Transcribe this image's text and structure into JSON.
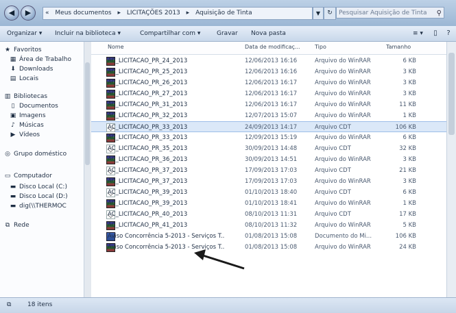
{
  "addressbar": {
    "segments": [
      "«",
      "Meus documentos",
      "▸",
      "LICITAÇÕES 2013",
      "▸",
      "Aquisição de Tinta"
    ],
    "search_placeholder": "Pesquisar Aquisição de Tinta"
  },
  "toolbar": {
    "organize": "Organizar ▾",
    "include": "Incluir na biblioteca ▾",
    "share": "Compartilhar com ▾",
    "burn": "Gravar",
    "newfolder": "Nova pasta",
    "view_icon": "≡ ▾",
    "pane_icon": "▯",
    "help_icon": "?"
  },
  "nav": {
    "favorites": "Favoritos",
    "desktop": "Área de Trabalho",
    "downloads": "Downloads",
    "recent": "Locais",
    "libraries": "Bibliotecas",
    "documents": "Documentos",
    "images": "Imagens",
    "music": "Músicas",
    "videos": "Vídeos",
    "homegroup": "Grupo doméstico",
    "computer": "Computador",
    "disk_c": "Disco Local (C:)",
    "disk_d": "Disco Local (D:)",
    "network_drive": "dig(\\\\THERMOC",
    "network": "Rede"
  },
  "columns": {
    "name": "Nome",
    "date": "Data de modificaç...",
    "type": "Tipo",
    "size": "Tamanho"
  },
  "files": [
    {
      "name": "AC_LICITACAO_PR_24_2013",
      "date": "12/06/2013 16:16",
      "type": "Arquivo do WinRAR",
      "size": "6 KB"
    },
    {
      "name": "AC_LICITACAO_PR_25_2013",
      "date": "12/06/2013 16:16",
      "type": "Arquivo do WinRAR",
      "size": "3 KB"
    },
    {
      "name": "AC_LICITACAO_PR_26_2013",
      "date": "12/06/2013 16:17",
      "type": "Arquivo do WinRAR",
      "size": "3 KB"
    },
    {
      "name": "AC_LICITACAO_PR_27_2013",
      "date": "12/06/2013 16:17",
      "type": "Arquivo do WinRAR",
      "size": "3 KB"
    },
    {
      "name": "AC_LICITACAO_PR_31_2013",
      "date": "12/06/2013 16:17",
      "type": "Arquivo do WinRAR",
      "size": "11 KB"
    },
    {
      "name": "AC_LICITACAO_PR_32_2013",
      "date": "12/07/2013 15:07",
      "type": "Arquivo do WinRAR",
      "size": "1 KB"
    },
    {
      "name": "AC_LICITACAO_PR_33_2013",
      "date": "24/09/2013 14:17",
      "type": "Arquivo CDT",
      "size": "106 KB"
    },
    {
      "name": "AC_LICITACAO_PR_33_2013",
      "date": "12/09/2013 15:19",
      "type": "Arquivo do WinRAR",
      "size": "6 KB"
    },
    {
      "name": "AC_LICITACAO_PR_35_2013",
      "date": "30/09/2013 14:48",
      "type": "Arquivo CDT",
      "size": "32 KB"
    },
    {
      "name": "AC_LICITACAO_PR_36_2013",
      "date": "30/09/2013 14:51",
      "type": "Arquivo do WinRAR",
      "size": "3 KB"
    },
    {
      "name": "AC_LICITACAO_PR_37_2013",
      "date": "17/09/2013 17:03",
      "type": "Arquivo CDT",
      "size": "21 KB"
    },
    {
      "name": "AC_LICITACAO_PR_37_2013",
      "date": "17/09/2013 17:03",
      "type": "Arquivo do WinRAR",
      "size": "3 KB"
    },
    {
      "name": "AC_LICITACAO_PR_39_2013",
      "date": "01/10/2013 18:40",
      "type": "Arquivo CDT",
      "size": "6 KB"
    },
    {
      "name": "AC_LICITACAO_PR_39_2013",
      "date": "01/10/2013 18:41",
      "type": "Arquivo do WinRAR",
      "size": "1 KB"
    },
    {
      "name": "AC_LICITACAO_PR_40_2013",
      "date": "08/10/2013 11:31",
      "type": "Arquivo CDT",
      "size": "17 KB"
    },
    {
      "name": "AC_LICITACAO_PR_41_2013",
      "date": "08/10/2013 11:32",
      "type": "Arquivo do WinRAR",
      "size": "5 KB"
    },
    {
      "name": "Aviso Concorrência 5-2013 - Serviços T...",
      "date": "01/08/2013 15:08",
      "type": "Documento do Mi...",
      "size": "106 KB"
    },
    {
      "name": "Aviso Concorrência 5-2013 - Serviços T...",
      "date": "01/08/2013 15:08",
      "type": "Arquivo do WinRAR",
      "size": "24 KB"
    }
  ],
  "status": {
    "count": "18 itens"
  },
  "colors": {
    "accent": "#9cb7d4",
    "selection": "#dbe8f8",
    "arrow": "#1a1a1a"
  }
}
